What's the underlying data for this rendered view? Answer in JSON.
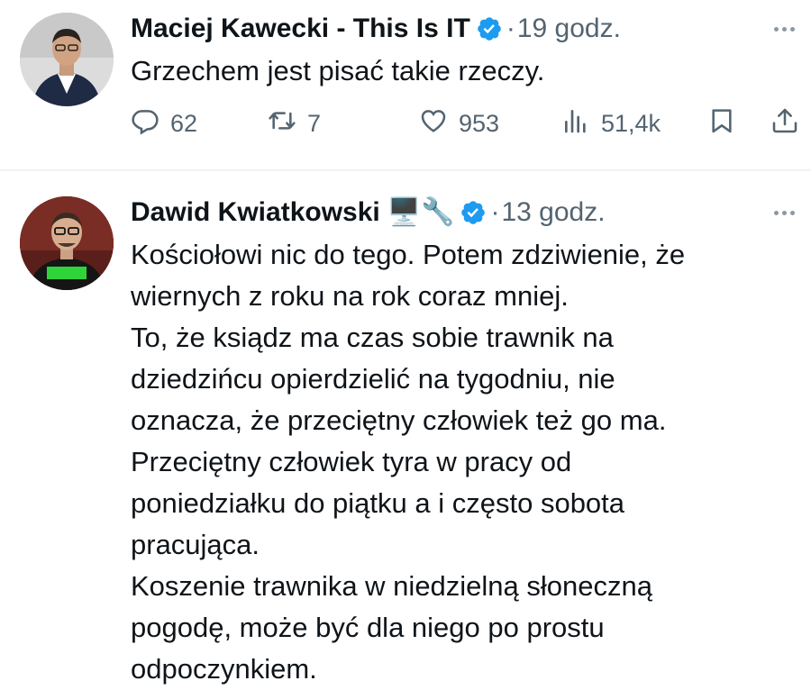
{
  "tweets": [
    {
      "author": "Maciej Kawecki - This Is IT",
      "separator": "·",
      "time": "19 godz.",
      "text": "Grzechem jest pisać takie rzeczy.",
      "replies": "62",
      "reposts": "7",
      "likes": "953",
      "views": "51,4k"
    },
    {
      "author": "Dawid Kwiatkowski",
      "emoji": "🖥️🔧",
      "separator": "·",
      "time": "13 godz.",
      "text": "Kościołowi nic do tego. Potem zdziwienie, że\nwiernych z roku na rok coraz mniej.\nTo, że ksiądz ma czas sobie trawnik na\ndziedzińcu opierdzielić na tygodniu, nie\noznacza, że przeciętny człowiek też go ma.\nPrzeciętny człowiek tyra w pracy od\nponiedziałku do piątku a i często sobota\npracująca.\nKoszenie trawnika w niedzielną słoneczną\npogodę, może być dla niego po prostu\nodpoczynkiem."
    }
  ],
  "colors": {
    "text": "#0f1419",
    "secondary": "#536471",
    "verified": "#1d9bf0",
    "divider": "#eff3f4"
  },
  "icons": [
    "reply-icon",
    "repost-icon",
    "like-icon",
    "views-icon",
    "bookmark-icon",
    "share-icon",
    "more-icon",
    "verified-badge-icon"
  ]
}
